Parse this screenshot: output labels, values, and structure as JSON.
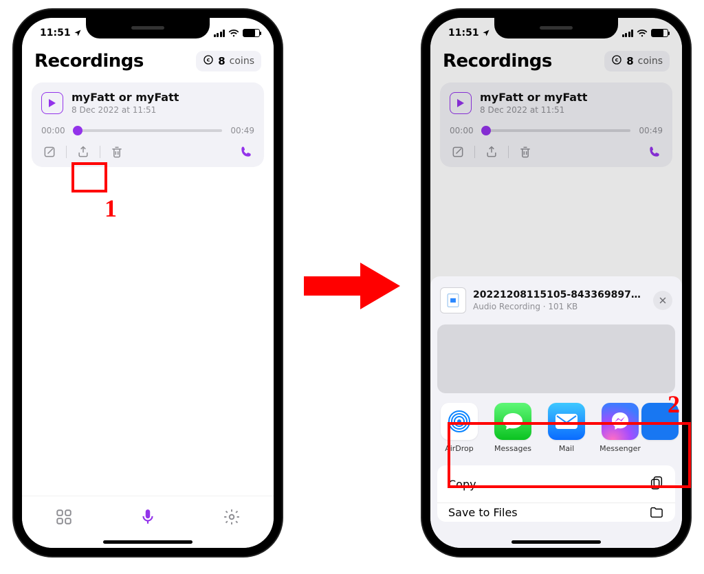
{
  "status": {
    "time": "11:51"
  },
  "header": {
    "title": "Recordings",
    "coins_value": "8",
    "coins_label": "coins"
  },
  "recording": {
    "title": "myFatt or myFatt",
    "date": "8 Dec 2022 at 11:51",
    "start": "00:00",
    "end": "00:49"
  },
  "share": {
    "file_name": "20221208115105-8433698977…",
    "file_type": "Audio Recording",
    "file_size": "101 KB",
    "apps": {
      "airdrop": "AirDrop",
      "messages": "Messages",
      "mail": "Mail",
      "messenger": "Messenger"
    },
    "menu": {
      "copy": "Copy",
      "savefiles": "Save to Files"
    }
  },
  "annotations": {
    "label1": "1",
    "label2": "2"
  }
}
